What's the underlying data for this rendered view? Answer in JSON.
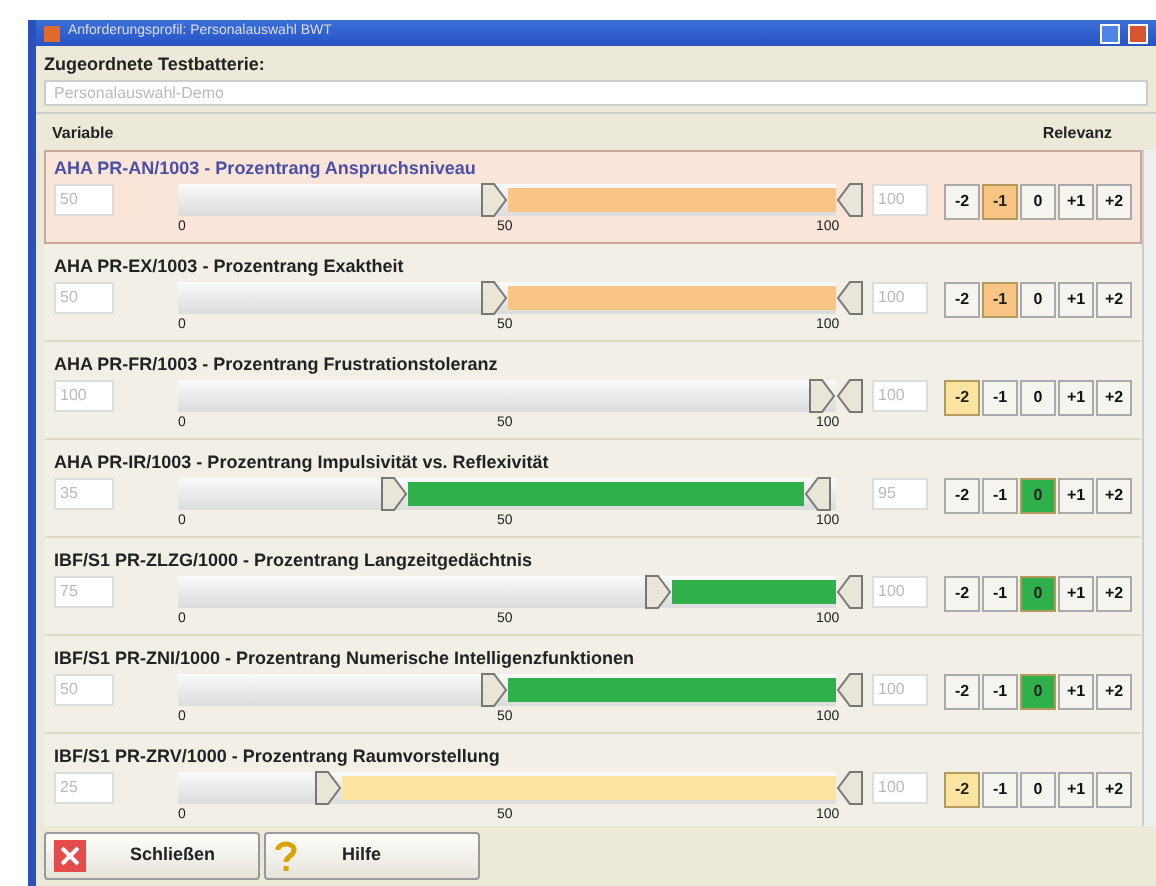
{
  "window": {
    "title": "Anforderungsprofil: Personalauswahl BWT"
  },
  "battery": {
    "label": "Zugeordnete Testbatterie:",
    "value": "Personalauswahl-Demo"
  },
  "table": {
    "columns": [
      "Variable",
      "Relevanz"
    ],
    "rows": [
      {
        "name": "AHA PR-AN/1003 - Prozentrang Anspruchsniveau",
        "selected": true,
        "low": "50",
        "high": "100",
        "handles": [
          {
            "level": 0.5
          },
          {
            "level": 1
          }
        ],
        "scale": [
          "0",
          "50",
          "100"
        ],
        "color": "#f9c584",
        "relevance": [
          {
            "label": "-2",
            "selected": false
          },
          {
            "label": "-1",
            "selected": true
          },
          {
            "label": "0",
            "selected": false
          },
          {
            "label": "+1",
            "selected": false
          },
          {
            "label": "+2",
            "selected": false
          }
        ]
      },
      {
        "name": "AHA PR-EX/1003 - Prozentrang Exaktheit",
        "selected": false,
        "low": "50",
        "high": "100",
        "handles": [
          {
            "level": 0.5
          },
          {
            "level": 1
          }
        ],
        "scale": [
          "0",
          "50",
          "100"
        ],
        "color": "#f9c584",
        "relevance": [
          {
            "label": "-2",
            "selected": false
          },
          {
            "label": "-1",
            "selected": true
          },
          {
            "label": "0",
            "selected": false
          },
          {
            "label": "+1",
            "selected": false
          },
          {
            "label": "+2",
            "selected": false
          }
        ]
      },
      {
        "name": "AHA PR-FR/1003 - Prozentrang Frustrationstoleranz",
        "selected": false,
        "low": "100",
        "high": "100",
        "handles": [
          {
            "level": 1
          },
          {
            "level": 1
          }
        ],
        "scale": [
          "0",
          "50",
          "100"
        ],
        "color": "#fbe3a0",
        "relevance": [
          {
            "label": "-2",
            "selected": true
          },
          {
            "label": "-1",
            "selected": false
          },
          {
            "label": "0",
            "selected": false
          },
          {
            "label": "+1",
            "selected": false
          },
          {
            "label": "+2",
            "selected": false
          }
        ]
      },
      {
        "name": "AHA PR-IR/1003 - Prozentrang Impulsivität vs. Reflexivität",
        "selected": false,
        "low": "35",
        "high": "95",
        "handles": [
          {
            "level": 0.35
          },
          {
            "level": 0.95
          }
        ],
        "scale": [
          "0",
          "50",
          "100"
        ],
        "color": "#2fb04a",
        "relevance": [
          {
            "label": "-2",
            "selected": false
          },
          {
            "label": "-1",
            "selected": false
          },
          {
            "label": "0",
            "selected": true
          },
          {
            "label": "+1",
            "selected": false
          },
          {
            "label": "+2",
            "selected": false
          }
        ]
      },
      {
        "name": "IBF/S1 PR-ZLZG/1000 - Prozentrang Langzeitgedächtnis",
        "selected": false,
        "low": "75",
        "high": "100",
        "handles": [
          {
            "level": 0.75
          },
          {
            "level": 1
          }
        ],
        "scale": [
          "0",
          "50",
          "100"
        ],
        "color": "#2fb04a",
        "relevance": [
          {
            "label": "-2",
            "selected": false
          },
          {
            "label": "-1",
            "selected": false
          },
          {
            "label": "0",
            "selected": true
          },
          {
            "label": "+1",
            "selected": false
          },
          {
            "label": "+2",
            "selected": false
          }
        ]
      },
      {
        "name": "IBF/S1 PR-ZNI/1000 - Prozentrang Numerische Intelligenzfunktionen",
        "selected": false,
        "low": "50",
        "high": "100",
        "handles": [
          {
            "level": 0.5
          },
          {
            "level": 1
          }
        ],
        "scale": [
          "0",
          "50",
          "100"
        ],
        "color": "#2fb04a",
        "relevance": [
          {
            "label": "-2",
            "selected": false
          },
          {
            "label": "-1",
            "selected": false
          },
          {
            "label": "0",
            "selected": true
          },
          {
            "label": "+1",
            "selected": false
          },
          {
            "label": "+2",
            "selected": false
          }
        ]
      },
      {
        "name": "IBF/S1 PR-ZRV/1000 - Prozentrang Raumvorstellung",
        "selected": false,
        "low": "25",
        "high": "100",
        "handles": [
          {
            "level": 0.25
          },
          {
            "level": 1
          }
        ],
        "scale": [
          "0",
          "50",
          "100"
        ],
        "color": "#fbe3a0",
        "relevance": [
          {
            "label": "-2",
            "selected": true
          },
          {
            "label": "-1",
            "selected": false
          },
          {
            "label": "0",
            "selected": false
          },
          {
            "label": "+1",
            "selected": false
          },
          {
            "label": "+2",
            "selected": false
          }
        ]
      }
    ]
  },
  "buttons": [
    {
      "kind": "close",
      "label": "Schließen"
    },
    {
      "kind": "help",
      "label": "Hilfe"
    }
  ]
}
